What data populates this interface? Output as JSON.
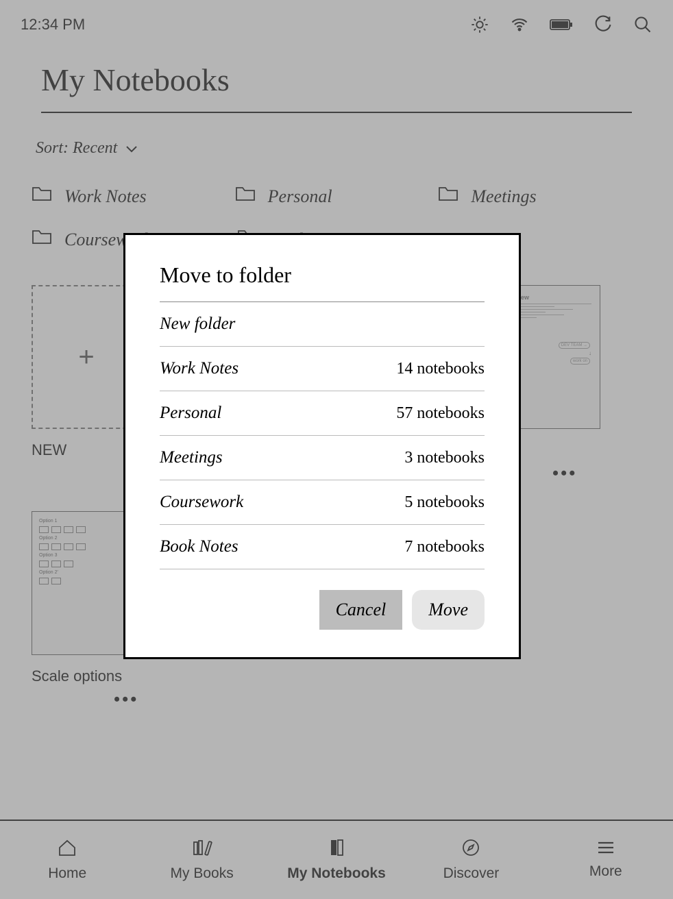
{
  "status": {
    "time": "12:34 PM"
  },
  "page": {
    "title": "My Notebooks",
    "sort_label": "Sort: Recent"
  },
  "folders": [
    {
      "name": "Work Notes"
    },
    {
      "name": "Personal"
    },
    {
      "name": "Meetings"
    },
    {
      "name": "Coursework"
    },
    {
      "name": "Book Notes"
    }
  ],
  "notebooks": {
    "new_label": "NEW",
    "review_title": "UX review",
    "review_label_suffix": "w",
    "scale_label": "Scale options"
  },
  "modal": {
    "title": "Move to folder",
    "new_folder": "New folder",
    "rows": [
      {
        "name": "Work Notes",
        "count": "14 notebooks"
      },
      {
        "name": "Personal",
        "count": "57 notebooks"
      },
      {
        "name": "Meetings",
        "count": "3 notebooks"
      },
      {
        "name": "Coursework",
        "count": "5 notebooks"
      },
      {
        "name": "Book Notes",
        "count": "7 notebooks"
      }
    ],
    "cancel": "Cancel",
    "move": "Move"
  },
  "nav": {
    "home": "Home",
    "books": "My Books",
    "notebooks": "My Notebooks",
    "discover": "Discover",
    "more": "More"
  },
  "thumb_decor": {
    "option1": "Option 1",
    "option2": "Option 2",
    "option3": "Option 3",
    "option4": "Option 2'",
    "dev_team": "DEV TEAM →",
    "workon": "work on"
  }
}
